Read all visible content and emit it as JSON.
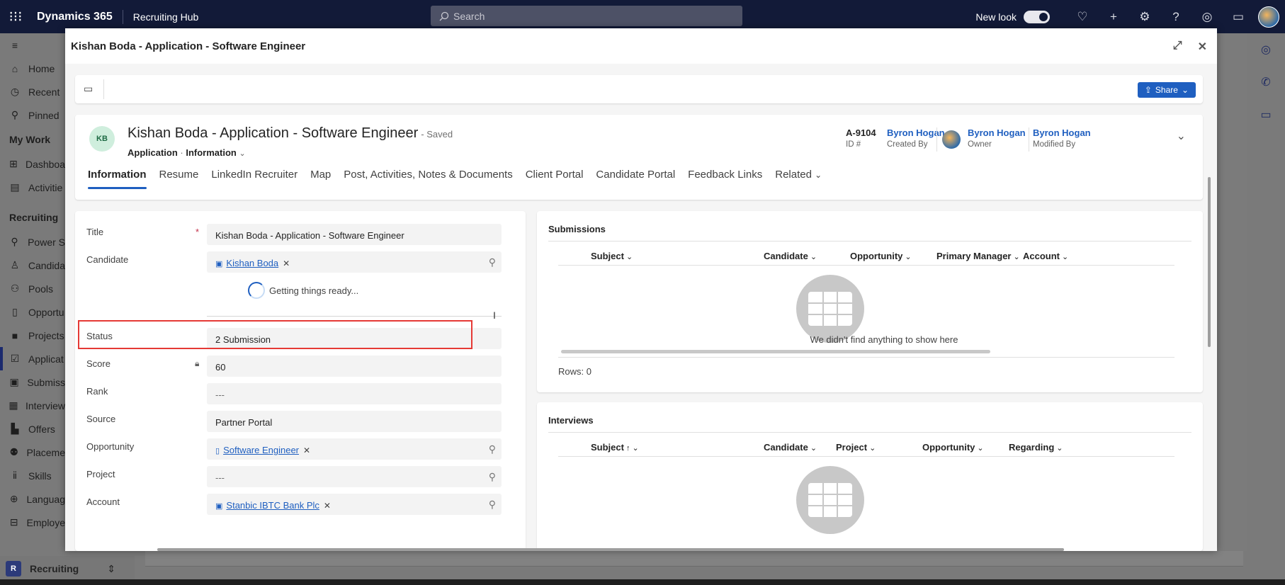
{
  "topbar": {
    "app": "Dynamics 365",
    "hub": "Recruiting Hub",
    "search_placeholder": "Search",
    "new_look": "New look"
  },
  "leftnav": {
    "items": [
      {
        "label": "Home",
        "icon": "home-icon"
      },
      {
        "label": "Recent",
        "icon": "clock-icon"
      },
      {
        "label": "Pinned",
        "icon": "pin-icon"
      }
    ],
    "section_mywork": "My Work",
    "mywork": [
      {
        "label": "Dashboa"
      },
      {
        "label": "Activitie"
      }
    ],
    "section_recruiting": "Recruiting",
    "recruiting": [
      {
        "label": "Power S"
      },
      {
        "label": "Candida"
      },
      {
        "label": "Pools"
      },
      {
        "label": "Opportu"
      },
      {
        "label": "Projects"
      },
      {
        "label": "Applicat"
      },
      {
        "label": "Submiss"
      },
      {
        "label": "Interview"
      },
      {
        "label": "Offers"
      },
      {
        "label": "Placeme"
      },
      {
        "label": "Skills"
      },
      {
        "label": "Languag"
      },
      {
        "label": "Employe"
      }
    ],
    "area_switcher": {
      "badge": "R",
      "label": "Recruiting"
    }
  },
  "dialog": {
    "title": "Kishan Boda - Application - Software Engineer",
    "share": "Share",
    "record": {
      "initials": "KB",
      "title": "Kishan Boda - Application - Software Engineer",
      "saved": "- Saved",
      "entity": "Application",
      "form": "Information"
    },
    "header_fields": [
      {
        "value": "A-9104",
        "label": "ID #"
      },
      {
        "value": "Byron Hogan",
        "label": "Created By"
      },
      {
        "value": "Byron Hogan",
        "label": "Owner"
      },
      {
        "value": "Byron Hogan",
        "label": "Modified By"
      }
    ],
    "tabs": [
      "Information",
      "Resume",
      "LinkedIn Recruiter",
      "Map",
      "Post, Activities, Notes & Documents",
      "Client Portal",
      "Candidate Portal",
      "Feedback Links",
      "Related"
    ],
    "form": {
      "title_label": "Title",
      "title_value": "Kishan Boda - Application - Software Engineer",
      "candidate_label": "Candidate",
      "candidate_value": "Kishan Boda",
      "loading_text": "Getting things ready...",
      "status_label": "Status",
      "status_value": "2 Submission",
      "score_label": "Score",
      "score_value": "60",
      "rank_label": "Rank",
      "rank_value": "---",
      "source_label": "Source",
      "source_value": "Partner Portal",
      "opportunity_label": "Opportunity",
      "opportunity_value": "Software Engineer",
      "project_label": "Project",
      "project_value": "---",
      "account_label": "Account",
      "account_value": "Stanbic IBTC Bank Plc"
    },
    "submissions": {
      "title": "Submissions",
      "columns": [
        "Subject",
        "Candidate",
        "Opportunity",
        "Primary Manager",
        "Account"
      ],
      "empty_text": "We didn't find anything to show here",
      "rows": "Rows: 0"
    },
    "interviews": {
      "title": "Interviews",
      "columns": [
        "Subject",
        "Candidate",
        "Project",
        "Opportunity",
        "Regarding"
      ]
    }
  }
}
